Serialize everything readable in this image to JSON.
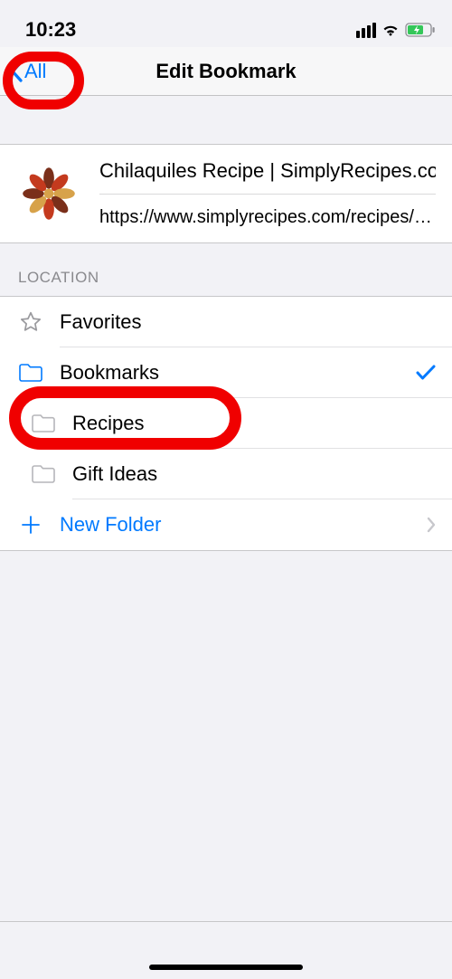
{
  "statusbar": {
    "time": "10:23"
  },
  "nav": {
    "back_label": "All",
    "title": "Edit Bookmark"
  },
  "bookmark": {
    "title": "Chilaquiles Recipe | SimplyRecipes.com",
    "url": "https://www.simplyrecipes.com/recipes/chilaq…"
  },
  "location": {
    "header": "LOCATION",
    "favorites": "Favorites",
    "bookmarks": "Bookmarks",
    "recipes": "Recipes",
    "giftideas": "Gift Ideas",
    "newfolder": "New Folder",
    "selected": "bookmarks"
  }
}
